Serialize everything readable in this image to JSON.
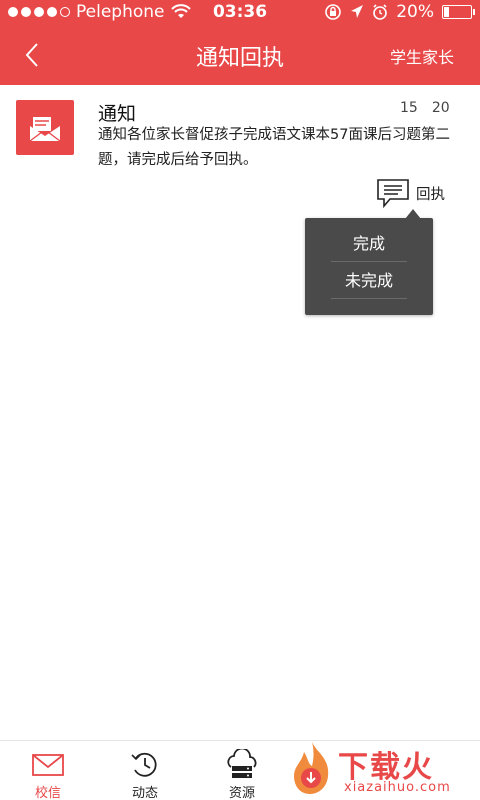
{
  "status_bar": {
    "carrier": "Pelephone",
    "time": "03:36",
    "battery": "20%",
    "battery_level": 0.2
  },
  "nav": {
    "title": "通知回执",
    "right_label": "学生家长"
  },
  "notice": {
    "title": "通知",
    "time_hour": "15",
    "time_minute": "20",
    "body": "通知各位家长督促孩子完成语文课本57面课后习题第二题，请完成后给予回执。",
    "receipt_label": "回执"
  },
  "popup": {
    "options": [
      {
        "label": "完成"
      },
      {
        "label": "未完成"
      }
    ]
  },
  "tabs": [
    {
      "label": "校信",
      "icon": "mail-icon",
      "active": true
    },
    {
      "label": "动态",
      "icon": "history-icon",
      "active": false
    },
    {
      "label": "资源",
      "icon": "cloud-server-icon",
      "active": false
    }
  ],
  "watermark": {
    "brand": "下载火",
    "url": "xiazaihuo.com"
  },
  "colors": {
    "accent": "#e84848",
    "popup_bg": "#4a4a4a"
  }
}
